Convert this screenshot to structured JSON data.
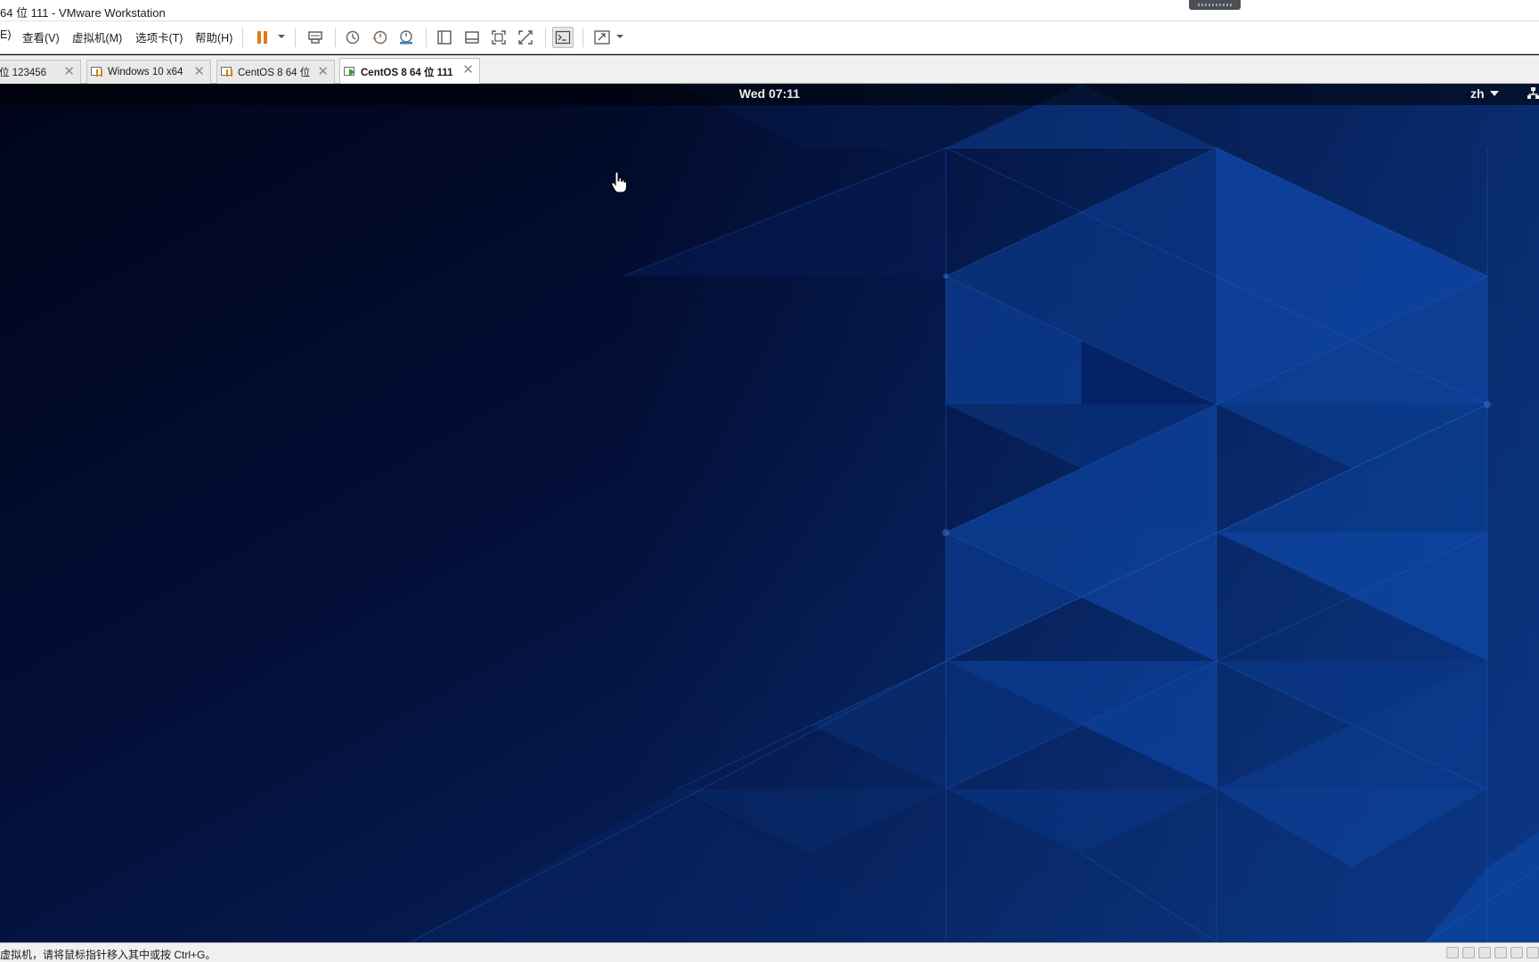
{
  "window": {
    "title": "64 位 111 - VMware Workstation"
  },
  "menu": {
    "file_fragment": "E)",
    "view": "查看(V)",
    "vm": "虚拟机(M)",
    "tabs": "选项卡(T)",
    "help": "帮助(H)"
  },
  "toolbar": {
    "icons": [
      "pause-icon",
      "dropdown-arrow-icon",
      "send-ctrl-alt-del-icon",
      "snapshot-icon",
      "revert-snapshot-icon",
      "snapshot-manager-icon",
      "library-icon",
      "thumbnail-bar-icon",
      "full-screen-icon",
      "unity-icon",
      "console-view-icon",
      "stretch-icon",
      "dropdown-arrow-icon"
    ]
  },
  "tabs": [
    {
      "label": "位 123456",
      "state": "paused"
    },
    {
      "label": "Windows 10 x64",
      "state": "paused"
    },
    {
      "label": "CentOS 8 64 位",
      "state": "paused"
    },
    {
      "label": "CentOS 8 64 位 111",
      "state": "running",
      "active": true
    }
  ],
  "guest": {
    "clock": "Wed 07:11",
    "language": "zh"
  },
  "status": {
    "text": "虚拟机，请将鼠标指针移入其中或按 Ctrl+G。"
  },
  "colors": {
    "wallpaper_dark": "#020a28",
    "wallpaper_blue": "#0d3f93",
    "accent_orange": "#e07b18",
    "running_green": "#2f9a3a"
  }
}
